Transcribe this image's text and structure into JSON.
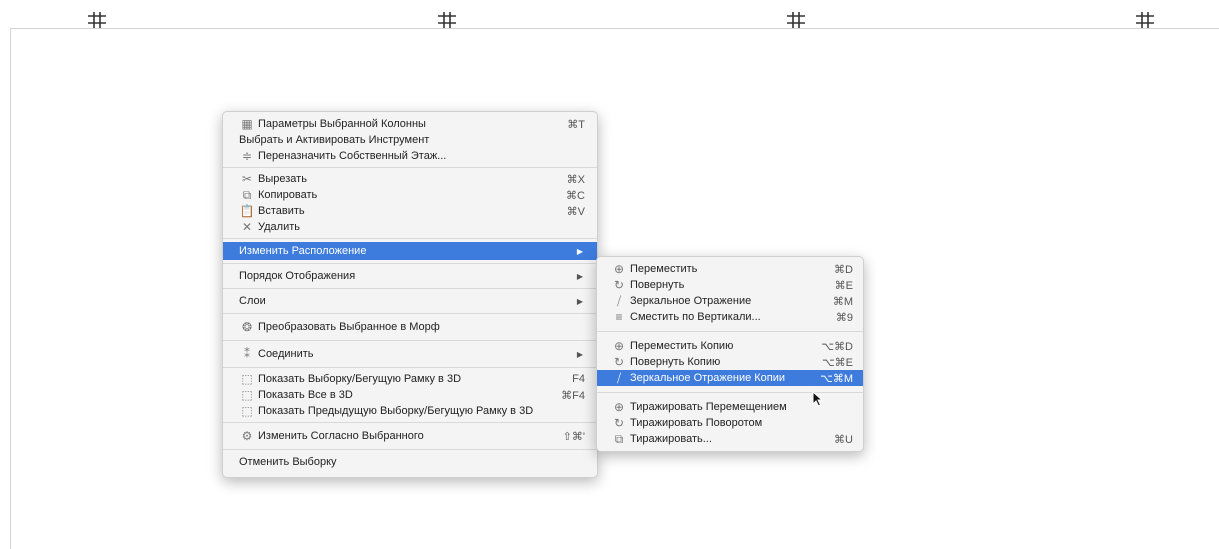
{
  "context_menu": {
    "items": [
      {
        "label": "Параметры Выбранной Колонны",
        "shortcut": "⌘T",
        "icon": "column-settings-icon"
      },
      {
        "label": "Выбрать и Активировать Инструмент",
        "shortcut": "",
        "icon": ""
      },
      {
        "label": "Переназначить Собственный Этаж...",
        "shortcut": "",
        "icon": "story-icon"
      },
      {
        "label": "Вырезать",
        "shortcut": "⌘X",
        "icon": "scissors-icon"
      },
      {
        "label": "Копировать",
        "shortcut": "⌘C",
        "icon": "copy-icon"
      },
      {
        "label": "Вставить",
        "shortcut": "⌘V",
        "icon": "paste-icon"
      },
      {
        "label": "Удалить",
        "shortcut": "",
        "icon": "delete-icon"
      },
      {
        "label": "Изменить Расположение",
        "shortcut": "",
        "submenu": true
      },
      {
        "label": "Порядок Отображения",
        "shortcut": "",
        "submenu": true
      },
      {
        "label": "Слои",
        "shortcut": "",
        "submenu": true
      },
      {
        "label": "Преобразовать Выбранное в Морф",
        "shortcut": "",
        "icon": "morph-icon"
      },
      {
        "label": "Соединить",
        "shortcut": "",
        "icon": "connect-icon",
        "submenu": true
      },
      {
        "label": "Показать Выборку/Бегущую Рамку в 3D",
        "shortcut": "F4",
        "icon": "show-3d-icon"
      },
      {
        "label": "Показать Все в 3D",
        "shortcut": "⌘F4",
        "icon": "show-all-3d-icon"
      },
      {
        "label": "Показать Предыдущую Выборку/Бегущую Рамку в 3D",
        "shortcut": "",
        "icon": "show-prev-3d-icon"
      },
      {
        "label": "Изменить Согласно Выбранного",
        "shortcut": "⇧⌘'",
        "icon": "edit-selection-icon"
      },
      {
        "label": "Отменить Выборку",
        "shortcut": ""
      }
    ]
  },
  "submenu": {
    "items": [
      {
        "label": "Переместить",
        "shortcut": "⌘D",
        "icon": "move-icon"
      },
      {
        "label": "Повернуть",
        "shortcut": "⌘E",
        "icon": "rotate-icon"
      },
      {
        "label": "Зеркальное Отражение",
        "shortcut": "⌘M",
        "icon": "mirror-icon"
      },
      {
        "label": "Сместить по Вертикали...",
        "shortcut": "⌘9",
        "icon": "elevate-icon"
      },
      {
        "label": "Переместить Копию",
        "shortcut": "⌥⌘D",
        "icon": "move-copy-icon"
      },
      {
        "label": "Повернуть Копию",
        "shortcut": "⌥⌘E",
        "icon": "rotate-copy-icon"
      },
      {
        "label": "Зеркальное Отражение Копии",
        "shortcut": "⌥⌘M",
        "icon": "mirror-copy-icon"
      },
      {
        "label": "Тиражировать Перемещением",
        "shortcut": "",
        "icon": "multiply-move-icon"
      },
      {
        "label": "Тиражировать Поворотом",
        "shortcut": "",
        "icon": "multiply-rotate-icon"
      },
      {
        "label": "Тиражировать...",
        "shortcut": "⌘U",
        "icon": "multiply-icon"
      }
    ]
  },
  "colors": {
    "highlight": "#3d7bdc",
    "menu_bg": "#f4f4f4"
  }
}
